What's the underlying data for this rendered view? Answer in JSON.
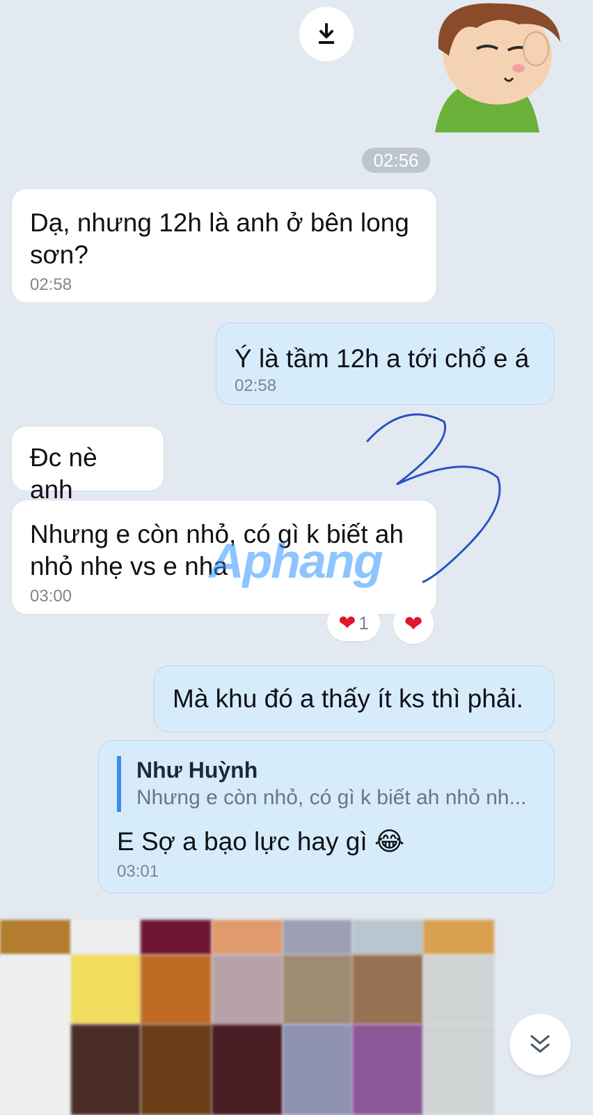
{
  "icons": {
    "download": "download-icon",
    "heart": "heart-icon",
    "scroll_down": "double-chevron-down-icon",
    "emoji": "tears-of-joy-emoji"
  },
  "top": {
    "time_pill": "02:56"
  },
  "messages": [
    {
      "side": "in",
      "text": "Dạ, nhưng 12h là anh ở bên long sơn?",
      "time": "02:58"
    },
    {
      "side": "out",
      "text": "Ý là tầm 12h a tới chổ e á",
      "time": "02:58"
    },
    {
      "side": "in",
      "text": "Đc nè anh"
    },
    {
      "side": "in",
      "text": "Nhưng e còn nhỏ, có gì k biết ah nhỏ nhẹ vs e nha",
      "time": "03:00"
    },
    {
      "side": "out",
      "text": "Mà khu đó a thấy ít ks thì phải."
    },
    {
      "side": "out",
      "quote": {
        "name": "Như Huỳnh",
        "text": "Nhưng e còn nhỏ, có gì k biết ah nhỏ nh..."
      },
      "text": "E Sợ a bạo lực hay gì",
      "emoji": "😂",
      "time": "03:01"
    }
  ],
  "reactions": {
    "count": "1"
  },
  "watermark": "Aphang",
  "colors": {
    "background": "#e2e9f1",
    "outgoing": "#d6ecfb",
    "incoming": "#ffffff",
    "accent": "#3a8bf2"
  }
}
